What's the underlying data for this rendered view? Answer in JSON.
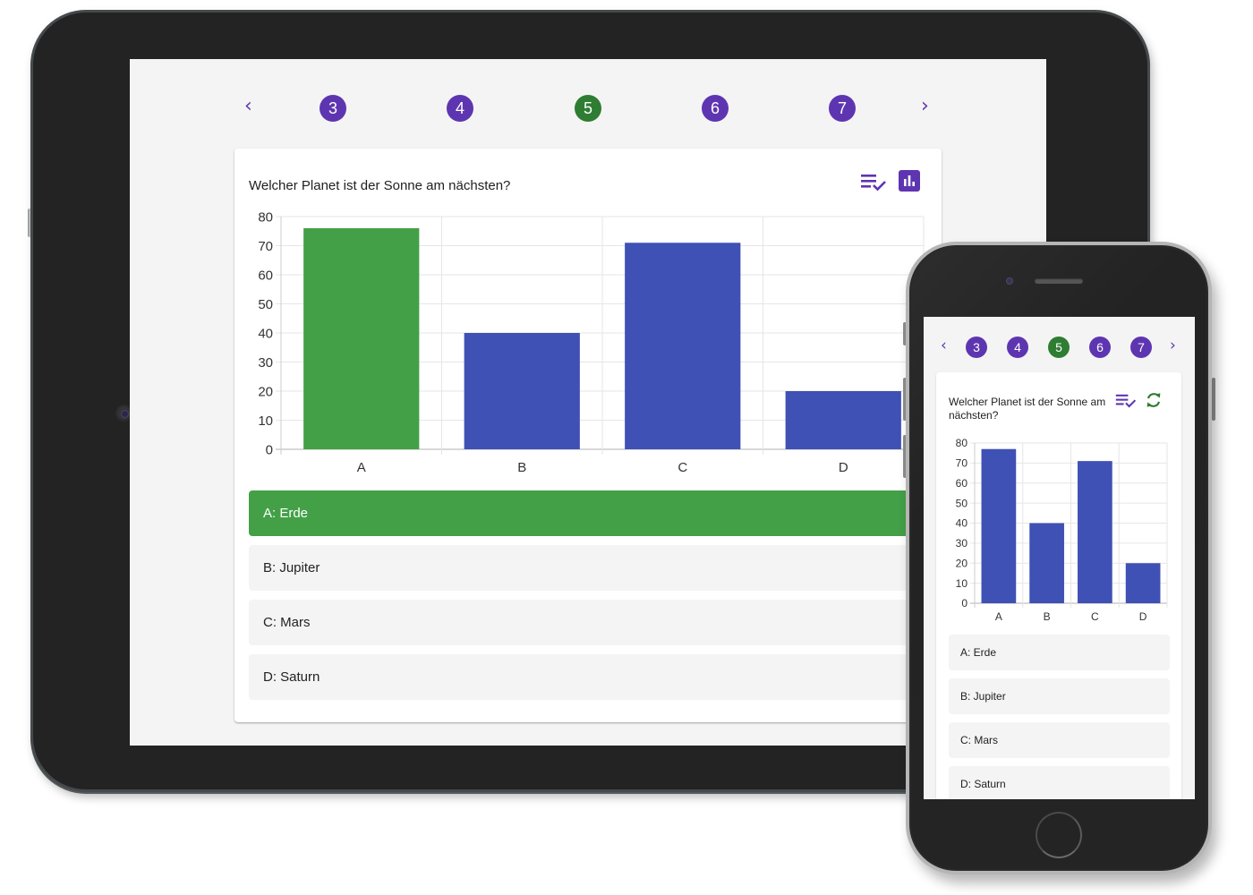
{
  "colors": {
    "accent": "#5e35b1",
    "active_page": "#2e7d32",
    "correct_bar": "#43a047",
    "default_bar": "#3f51b5",
    "grid": "#e6e6e6",
    "axis": "#cccccc"
  },
  "pager": {
    "prev_icon": "chevron-left-icon",
    "next_icon": "chevron-right-icon",
    "prev_label": "‹",
    "next_label": "›",
    "pages": [
      "3",
      "4",
      "5",
      "6",
      "7"
    ],
    "active_page": "5"
  },
  "tablet": {
    "question": "Welcher Planet ist der Sonne am nächsten?",
    "icons": [
      "answer-list-check-icon",
      "bar-chart-icon"
    ],
    "answers": [
      {
        "label": "A: Erde",
        "correct": true
      },
      {
        "label": "B: Jupiter",
        "correct": false
      },
      {
        "label": "C: Mars",
        "correct": false
      },
      {
        "label": "D: Saturn",
        "correct": false
      }
    ]
  },
  "phone": {
    "question": "Welcher Planet ist der Sonne am nächsten?",
    "icons": [
      "answer-list-check-icon",
      "refresh-icon"
    ],
    "answers": [
      {
        "label": "A: Erde"
      },
      {
        "label": "B: Jupiter"
      },
      {
        "label": "C: Mars"
      },
      {
        "label": "D: Saturn"
      }
    ]
  },
  "chart_data": [
    {
      "type": "bar",
      "title": "",
      "xlabel": "",
      "ylabel": "",
      "categories": [
        "A",
        "B",
        "C",
        "D"
      ],
      "values": [
        76,
        40,
        71,
        20
      ],
      "highlight_index": 0,
      "ylim": [
        0,
        80
      ],
      "yticks": [
        0,
        10,
        20,
        30,
        40,
        50,
        60,
        70,
        80
      ],
      "grid": true,
      "legend": "none"
    },
    {
      "type": "bar",
      "title": "",
      "xlabel": "",
      "ylabel": "",
      "categories": [
        "A",
        "B",
        "C",
        "D"
      ],
      "values": [
        77,
        40,
        71,
        20
      ],
      "highlight_index": null,
      "ylim": [
        0,
        80
      ],
      "yticks": [
        0,
        10,
        20,
        30,
        40,
        50,
        60,
        70,
        80
      ],
      "grid": true,
      "legend": "none"
    }
  ]
}
